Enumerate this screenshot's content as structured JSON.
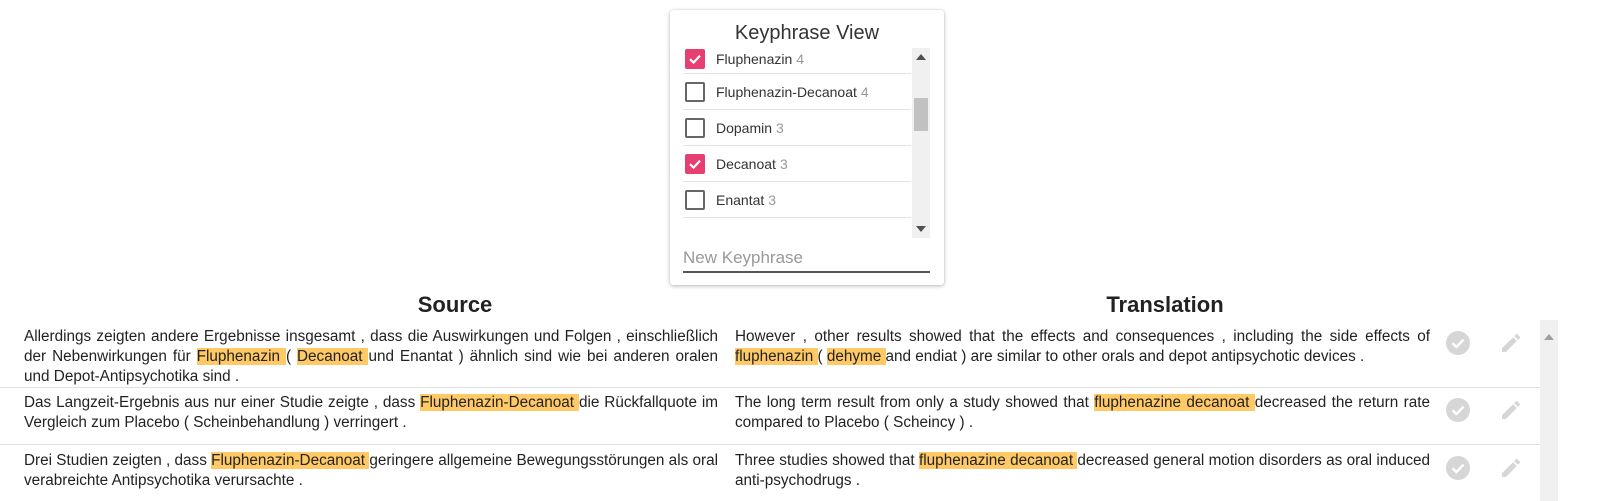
{
  "panel": {
    "title": "Keyphrase View",
    "new_keyphrase_placeholder": "New Keyphrase",
    "keyphrases": [
      {
        "label": "Fluphenazin",
        "count": "4",
        "checked": true
      },
      {
        "label": "Fluphenazin-Decanoat",
        "count": "4",
        "checked": false
      },
      {
        "label": "Dopamin",
        "count": "3",
        "checked": false
      },
      {
        "label": "Decanoat",
        "count": "3",
        "checked": true
      },
      {
        "label": "Enantat",
        "count": "3",
        "checked": false
      }
    ]
  },
  "columns": {
    "source": "Source",
    "translation": "Translation"
  },
  "colors": {
    "checkbox_accent": "#e83f73",
    "highlight": "#ffc966"
  },
  "rows": [
    {
      "source": [
        {
          "t": "Allerdings zeigten andere Ergebnisse insgesamt , dass die Auswirkungen und Folgen , einschließlich der Nebenwirkungen für "
        },
        {
          "t": "Fluphenazin ",
          "hl": true
        },
        {
          "t": "( "
        },
        {
          "t": "Decanoat ",
          "hl": true
        },
        {
          "t": "und Enantat ) ähnlich sind wie bei anderen oralen und Depot-Antipsychotika sind ."
        }
      ],
      "translation": [
        {
          "t": "However , other results showed that the effects and consequences , including the side effects of "
        },
        {
          "t": "fluphenazin ",
          "hl": true
        },
        {
          "t": "( "
        },
        {
          "t": "dehyme ",
          "hl": true
        },
        {
          "t": "and endiat ) are similar to other orals and depot antipsychotic devices ."
        }
      ]
    },
    {
      "source": [
        {
          "t": "Das Langzeit-Ergebnis aus nur einer Studie zeigte , dass "
        },
        {
          "t": "Fluphenazin-Decanoat  ",
          "hl": true
        },
        {
          "t": "die Rückfallquote im Vergleich zum Placebo ( Scheinbehandlung ) verringert ."
        }
      ],
      "translation": [
        {
          "t": "The long term result from only a study showed that "
        },
        {
          "t": "fluphenazine decanoat ",
          "hl": true
        },
        {
          "t": "decreased the return rate compared to Placebo ( Scheincy ) ."
        }
      ]
    },
    {
      "source": [
        {
          "t": "Drei Studien zeigten , dass "
        },
        {
          "t": "Fluphenazin-Decanoat ",
          "hl": true
        },
        {
          "t": "geringere allgemeine Bewegungsstörungen als oral verabreichte Antipsychotika verursachte ."
        }
      ],
      "translation": [
        {
          "t": "Three studies showed that "
        },
        {
          "t": "fluphenazine decanoat ",
          "hl": true
        },
        {
          "t": "decreased general motion disorders as oral induced anti-psychodrugs ."
        }
      ]
    }
  ]
}
